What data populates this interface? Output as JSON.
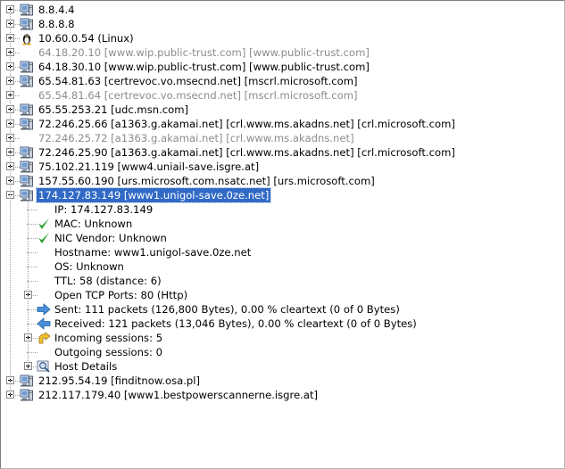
{
  "hosts": [
    {
      "label": "8.8.4.4",
      "icon": "computer-icon",
      "dim": false
    },
    {
      "label": "8.8.8.8",
      "icon": "computer-icon",
      "dim": false
    },
    {
      "label": "10.60.0.54 (Linux)",
      "icon": "linux-penguin-icon",
      "dim": false
    },
    {
      "label": "64.18.20.10 [www.wip.public-trust.com] [www.public-trust.com]",
      "icon": "none",
      "dim": true
    },
    {
      "label": "64.18.30.10 [www.wip.public-trust.com] [www.public-trust.com]",
      "icon": "computer-icon",
      "dim": false
    },
    {
      "label": "65.54.81.63 [certrevoc.vo.msecnd.net] [mscrl.microsoft.com]",
      "icon": "computer-icon",
      "dim": false
    },
    {
      "label": "65.54.81.64 [certrevoc.vo.msecnd.net] [mscrl.microsoft.com]",
      "icon": "none",
      "dim": true
    },
    {
      "label": "65.55.253.21 [udc.msn.com]",
      "icon": "computer-icon",
      "dim": false
    },
    {
      "label": "72.246.25.66 [a1363.g.akamai.net] [crl.www.ms.akadns.net] [crl.microsoft.com]",
      "icon": "computer-icon",
      "dim": false
    },
    {
      "label": "72.246.25.72 [a1363.g.akamai.net] [crl.www.ms.akadns.net]",
      "icon": "none",
      "dim": true
    },
    {
      "label": "72.246.25.90 [a1363.g.akamai.net] [crl.www.ms.akadns.net] [crl.microsoft.com]",
      "icon": "computer-icon",
      "dim": false
    },
    {
      "label": "75.102.21.119 [www4.uniail-save.isgre.at]",
      "icon": "computer-icon",
      "dim": false
    },
    {
      "label": "157.55.60.190 [urs.microsoft.com.nsatc.net] [urs.microsoft.com]",
      "icon": "computer-icon",
      "dim": false
    }
  ],
  "selected_host": {
    "label": "174.127.83.149 [www1.unigol-save.0ze.net]",
    "icon": "computer-icon",
    "children": [
      {
        "label": "IP: 174.127.83.149",
        "icon": "none",
        "expandable": false
      },
      {
        "label": "MAC: Unknown",
        "icon": "green-check-icon",
        "expandable": false
      },
      {
        "label": "NIC Vendor: Unknown",
        "icon": "green-check-icon",
        "expandable": false
      },
      {
        "label": "Hostname: www1.unigol-save.0ze.net",
        "icon": "none",
        "expandable": false
      },
      {
        "label": "OS: Unknown",
        "icon": "none",
        "expandable": false
      },
      {
        "label": "TTL: 58 (distance: 6)",
        "icon": "none",
        "expandable": false
      },
      {
        "label": "Open TCP Ports: 80 (Http)",
        "icon": "none",
        "expandable": true
      },
      {
        "label": "Sent: 111 packets (126,800 Bytes), 0.00 % cleartext (0 of 0 Bytes)",
        "icon": "arrow-right-icon",
        "expandable": false
      },
      {
        "label": "Received: 121 packets (13,046 Bytes), 0.00 % cleartext (0 of 0 Bytes)",
        "icon": "arrow-left-icon",
        "expandable": false
      },
      {
        "label": "Incoming sessions: 5",
        "icon": "incoming-session-icon",
        "expandable": true
      },
      {
        "label": "Outgoing sessions: 0",
        "icon": "none",
        "expandable": false
      },
      {
        "label": "Host Details",
        "icon": "magnifier-icon",
        "expandable": true
      }
    ]
  },
  "hosts_after": [
    {
      "label": "212.95.54.19 [finditnow.osa.pl]",
      "icon": "computer-icon",
      "dim": false
    },
    {
      "label": "212.117.179.40 [www1.bestpowerscannerne.isgre.at]",
      "icon": "computer-icon",
      "dim": false
    }
  ],
  "colors": {
    "selection": "#316ac5",
    "dim_text": "#8c8c8c",
    "check_green": "#2e9e2e",
    "arrow_blue": "#4a90d9"
  }
}
